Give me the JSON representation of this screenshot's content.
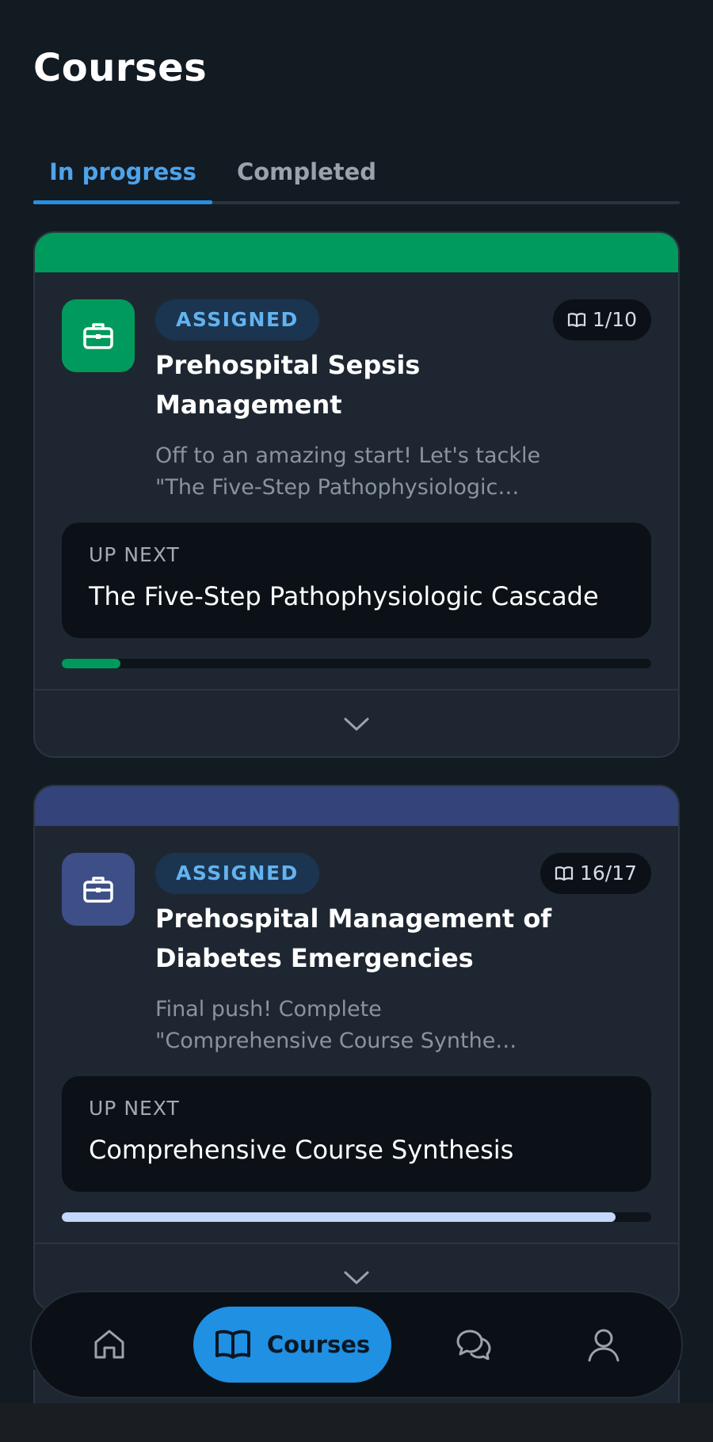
{
  "header": {
    "title": "Courses"
  },
  "tabs": [
    {
      "label": "In progress",
      "active": true
    },
    {
      "label": "Completed",
      "active": false
    }
  ],
  "colors": {
    "accent": "#2a8ee0",
    "green": "#009a5c",
    "indigo": "#34447a",
    "progress_light": "#c5d7fb"
  },
  "courses": [
    {
      "badge": "ASSIGNED",
      "progress_text": "1/10",
      "progress_fraction": 0.1,
      "title": "Prehospital Sepsis Management",
      "desc_line1": "Off to an amazing start! Let's tackle",
      "desc_line2": "\"The Five-Step Pathophysiologic…",
      "upnext_label": "UP NEXT",
      "upnext_title": "The Five-Step Pathophysiologic Cascade",
      "icon": "briefcase-icon",
      "color": "#009a5c"
    },
    {
      "badge": "ASSIGNED",
      "progress_text": "16/17",
      "progress_fraction": 0.94,
      "title": "Prehospital Management of Diabetes Emergencies",
      "desc_line1": "Final push! Complete",
      "desc_line2": "\"Comprehensive Course Synthe…",
      "upnext_label": "UP NEXT",
      "upnext_title": "Comprehensive Course Synthesis",
      "icon": "briefcase-icon",
      "color": "#34447a"
    }
  ],
  "nav": {
    "items": [
      {
        "icon": "home-icon"
      },
      {
        "icon": "book-icon",
        "label": "Courses",
        "active": true
      },
      {
        "icon": "chat-icon"
      },
      {
        "icon": "profile-icon"
      }
    ]
  }
}
